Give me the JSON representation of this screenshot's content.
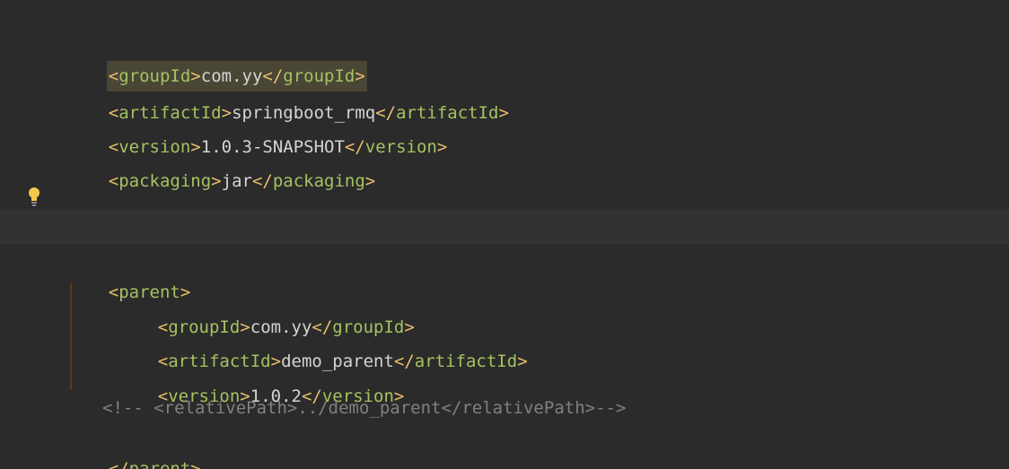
{
  "editor": {
    "lines": [
      {
        "open": "groupId",
        "value": "com.yy",
        "close": "groupId"
      },
      {
        "open": "artifactId",
        "value": "springboot_rmq",
        "close": "artifactId"
      },
      {
        "open": "version",
        "value": "1.0.3-SNAPSHOT",
        "close": "version"
      },
      {
        "open": "packaging",
        "value": "jar",
        "close": "packaging"
      },
      {
        "open": "parent"
      },
      {
        "open": "groupId",
        "value": "com.yy",
        "close": "groupId"
      },
      {
        "open": "artifactId",
        "value": "demo_parent",
        "close": "artifactId"
      },
      {
        "open": "version",
        "value": "1.0.2",
        "close": "version"
      },
      {
        "comment": "<!-- <relativePath>../demo_parent</relativePath>-->"
      },
      {
        "close": "parent"
      }
    ]
  },
  "colors": {
    "background": "#2b2b2b",
    "caret_line": "#323232",
    "tag_bracket": "#e8bf6a",
    "tag_name": "#a5c261",
    "text": "#d4d4d4",
    "comment": "#808080",
    "highlight": "#4a4636",
    "fold_guide": "#5e3b19",
    "bulb": "#f2c94c"
  },
  "icons": {
    "intention_bulb": "lightbulb-icon"
  }
}
